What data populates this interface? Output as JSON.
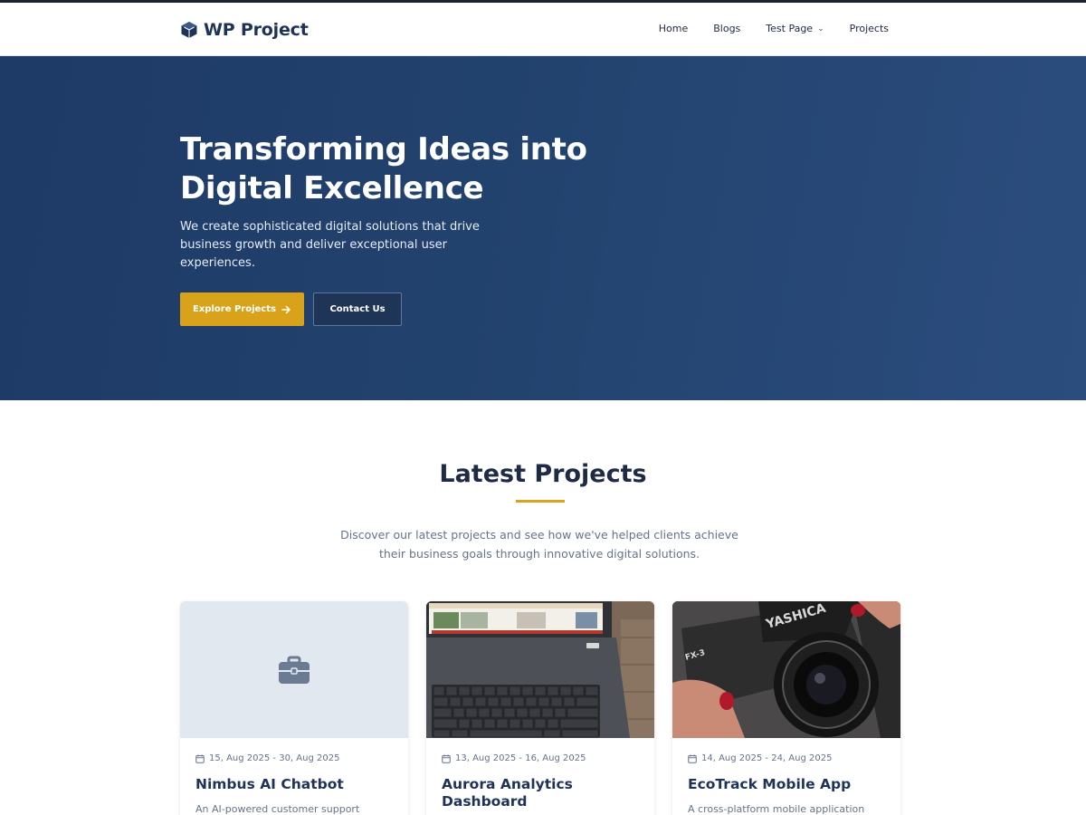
{
  "brand": {
    "name": "WP Project"
  },
  "nav": {
    "items": [
      {
        "label": "Home"
      },
      {
        "label": "Blogs"
      },
      {
        "label": "Test Page",
        "has_dropdown": true
      },
      {
        "label": "Projects"
      }
    ]
  },
  "hero": {
    "title": "Transforming Ideas into Digital Excellence",
    "subtitle": "We create sophisticated digital solutions that drive business growth and deliver exceptional user experiences.",
    "primary_button": "Explore Projects",
    "secondary_button": "Contact Us"
  },
  "projects_section": {
    "title": "Latest Projects",
    "description": "Discover our latest projects and see how we've helped clients achieve their business goals through innovative digital solutions.",
    "cards": [
      {
        "date": "15, Aug 2025 - 30, Aug 2025",
        "title": "Nimbus AI Chatbot",
        "description": "An AI-powered customer support",
        "media": "briefcase-icon-placeholder"
      },
      {
        "date": "13, Aug 2025 - 16, Aug 2025",
        "title": "Aurora Analytics Dashboard",
        "description": "",
        "media": "laptop-photo"
      },
      {
        "date": "14, Aug 2025 - 24, Aug 2025",
        "title": "EcoTrack Mobile App",
        "description": "A cross-platform mobile application",
        "media": "camera-photo"
      }
    ]
  },
  "colors": {
    "accent": "#d9a21b",
    "hero_bg": "#23436f",
    "heading": "#1f3358"
  }
}
